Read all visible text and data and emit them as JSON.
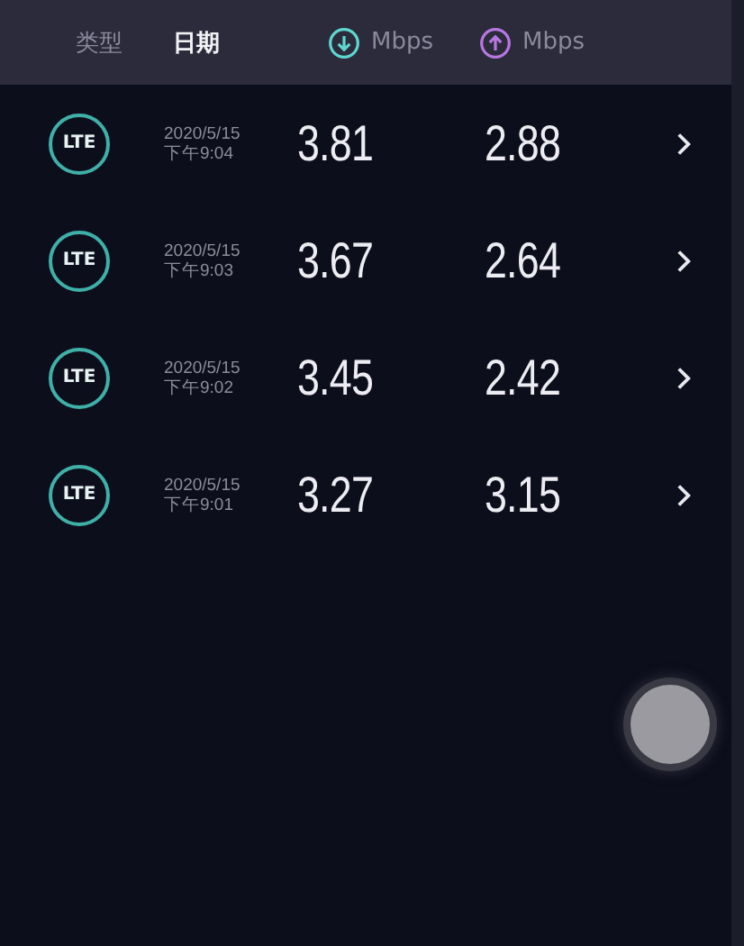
{
  "header": [
    {
      "kind": "text",
      "label": "类型",
      "selected": false
    },
    {
      "kind": "text",
      "label": "日期",
      "selected": true
    },
    {
      "kind": "download",
      "label": "Mbps",
      "selected": false
    },
    {
      "kind": "upload",
      "label": "Mbps",
      "selected": false
    }
  ],
  "rows": [
    {
      "type": "LTE",
      "date": "2020/5/15",
      "time": "下午9:04",
      "download": "3.81",
      "upload": "2.88"
    },
    {
      "type": "LTE",
      "date": "2020/5/15",
      "time": "下午9:03",
      "download": "3.67",
      "upload": "2.64"
    },
    {
      "type": "LTE",
      "date": "2020/5/15",
      "time": "下午9:02",
      "download": "3.45",
      "upload": "2.42"
    },
    {
      "type": "LTE",
      "date": "2020/5/15",
      "time": "下午9:01",
      "download": "3.27",
      "upload": "3.15"
    }
  ]
}
